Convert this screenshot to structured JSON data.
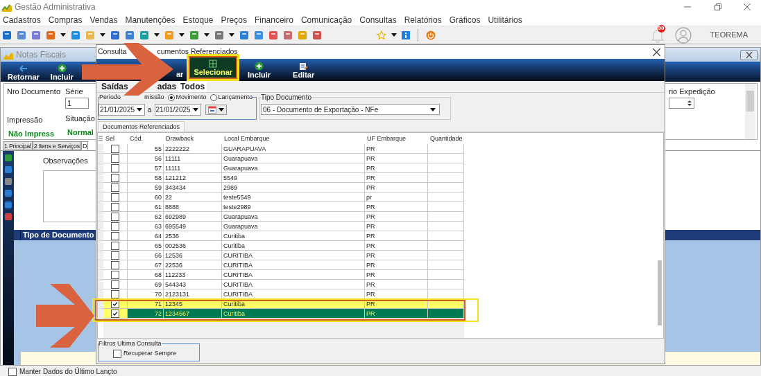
{
  "window": {
    "title": "Gestão Administrativa"
  },
  "menu": [
    "Cadastros",
    "Compras",
    "Vendas",
    "Manutenções",
    "Estoque",
    "Preços",
    "Financeiro",
    "Comunicação",
    "Consultas",
    "Relatórios",
    "Gráficos",
    "Utilitários"
  ],
  "toolbar": {
    "notification_count": "00",
    "user": "TEOREMA"
  },
  "notas_fiscais": {
    "title": "Notas Fiscais",
    "buttons": [
      "Retornar",
      "Incluir"
    ],
    "nro_label": "Nro Documento",
    "serie_label": "Série",
    "serie_value": "1",
    "impressao_label": "Impressão",
    "impressao_value": "Não Impress",
    "situacao_label": "Situação",
    "situacao_value": "Normal",
    "expedicao_label": "rio Expedição",
    "tabs": [
      {
        "label": "1 Principal",
        "selected": false
      },
      {
        "label": "2 Itens e Serviços",
        "selected": false
      },
      {
        "label": "D",
        "selected": true
      }
    ],
    "observacoes_label": "Observações",
    "grid_column": "Tipo de Documento",
    "keep_data": {
      "label": "Manter Dados do Último Lançto",
      "checked": false
    }
  },
  "dialog": {
    "title_parts": [
      "Consulta",
      "cumentos Referenciados"
    ],
    "buttons": [
      {
        "label": "ar",
        "hovered": false
      },
      {
        "label": "Selecionar",
        "hovered": true
      },
      {
        "label": "Incluir",
        "hovered": false
      },
      {
        "label": "Editar",
        "hovered": false
      }
    ],
    "tabs": [
      {
        "label": "Saídas",
        "selected": false
      },
      {
        "label": "adas",
        "selected": false
      },
      {
        "label": "Todos",
        "selected": true
      }
    ],
    "period": {
      "legend": "Periodo",
      "partial_label": "missão",
      "radios": [
        {
          "label": "Movimento",
          "selected": true
        },
        {
          "label": "Lançamento",
          "selected": false
        }
      ],
      "from": "21/01/2025",
      "connector": "a",
      "to": "21/01/2025"
    },
    "tipo_documento": {
      "label": "Tipo Documento",
      "value": "06 - Documento de Exportação - NFe"
    },
    "grid_tab": "Documentos Referenciados",
    "columns": [
      "Sel",
      "Cód.",
      "Drawback",
      "Local Embarque",
      "UF Embarque",
      "Quantidade"
    ],
    "rows": [
      {
        "checked": false,
        "cod": "55",
        "drawback": "2222222",
        "local": "GUARAPUAVA",
        "uf": "PR",
        "selected": false,
        "highlighted": false
      },
      {
        "checked": false,
        "cod": "56",
        "drawback": "11111",
        "local": "Guarapuava",
        "uf": "PR",
        "selected": false,
        "highlighted": false
      },
      {
        "checked": false,
        "cod": "57",
        "drawback": "11111",
        "local": "Guarapuava",
        "uf": "PR",
        "selected": false,
        "highlighted": false
      },
      {
        "checked": false,
        "cod": "58",
        "drawback": "121212",
        "local": "5549",
        "uf": "PR",
        "selected": false,
        "highlighted": false
      },
      {
        "checked": false,
        "cod": "59",
        "drawback": "343434",
        "local": "2989",
        "uf": "PR",
        "selected": false,
        "highlighted": false
      },
      {
        "checked": false,
        "cod": "60",
        "drawback": "22",
        "local": "teste5549",
        "uf": "pr",
        "selected": false,
        "highlighted": false
      },
      {
        "checked": false,
        "cod": "61",
        "drawback": "8888",
        "local": "teste2989",
        "uf": "PR",
        "selected": false,
        "highlighted": false
      },
      {
        "checked": false,
        "cod": "62",
        "drawback": "692989",
        "local": "Guarapuava",
        "uf": "PR",
        "selected": false,
        "highlighted": false
      },
      {
        "checked": false,
        "cod": "63",
        "drawback": "695549",
        "local": "Guarapuava",
        "uf": "PR",
        "selected": false,
        "highlighted": false
      },
      {
        "checked": false,
        "cod": "64",
        "drawback": "2536",
        "local": "Curitiba",
        "uf": "PR",
        "selected": false,
        "highlighted": false
      },
      {
        "checked": false,
        "cod": "65",
        "drawback": "002536",
        "local": "Curitiba",
        "uf": "PR",
        "selected": false,
        "highlighted": false
      },
      {
        "checked": false,
        "cod": "66",
        "drawback": "12536",
        "local": "CURITIBA",
        "uf": "PR",
        "selected": false,
        "highlighted": false
      },
      {
        "checked": false,
        "cod": "67",
        "drawback": "22536",
        "local": "CURITIBA",
        "uf": "PR",
        "selected": false,
        "highlighted": false
      },
      {
        "checked": false,
        "cod": "68",
        "drawback": "112233",
        "local": "CURITIBA",
        "uf": "PR",
        "selected": false,
        "highlighted": false
      },
      {
        "checked": false,
        "cod": "69",
        "drawback": "544343",
        "local": "CURITIBA",
        "uf": "PR",
        "selected": false,
        "highlighted": false
      },
      {
        "checked": false,
        "cod": "70",
        "drawback": "2123131",
        "local": "CURITIBA",
        "uf": "PR",
        "selected": false,
        "highlighted": false
      },
      {
        "checked": true,
        "cod": "71",
        "drawback": "12345",
        "local": "Curitiba",
        "uf": "PR",
        "selected": false,
        "highlighted": true
      },
      {
        "checked": true,
        "cod": "72",
        "drawback": "1234567",
        "local": "Curitiba",
        "uf": "PR",
        "selected": true,
        "highlighted": false
      }
    ],
    "filters": {
      "title": "Filtros Ultima Consulta",
      "checkbox": {
        "label": "Recuperar Sempre",
        "checked": false
      }
    }
  }
}
